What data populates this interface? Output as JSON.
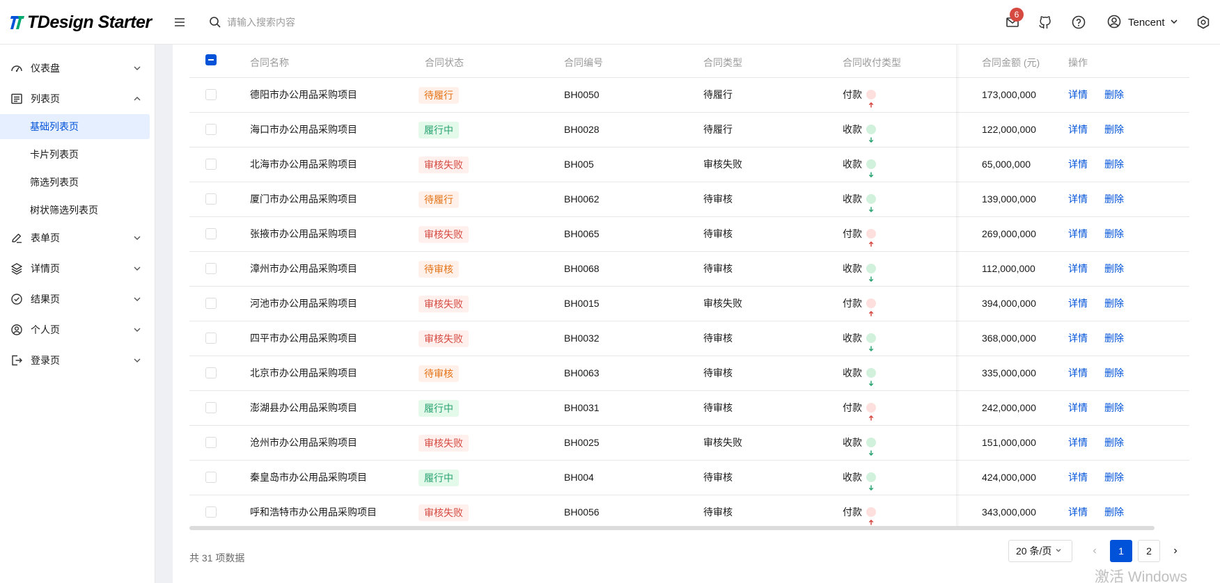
{
  "brand": {
    "name": "TDesign Starter",
    "color": "#0052d9",
    "accent": "#00a870"
  },
  "header": {
    "search_placeholder": "请输入搜索内容",
    "notification_count": "6",
    "user_name": "Tencent"
  },
  "sidebar": {
    "items": [
      {
        "label": "仪表盘",
        "icon": "dashboard-icon",
        "expanded": false
      },
      {
        "label": "列表页",
        "icon": "list-icon",
        "expanded": true,
        "children": [
          {
            "label": "基础列表页",
            "active": true
          },
          {
            "label": "卡片列表页",
            "active": false
          },
          {
            "label": "筛选列表页",
            "active": false
          },
          {
            "label": "树状筛选列表页",
            "active": false
          }
        ]
      },
      {
        "label": "表单页",
        "icon": "edit-icon",
        "expanded": false
      },
      {
        "label": "详情页",
        "icon": "layers-icon",
        "expanded": false
      },
      {
        "label": "结果页",
        "icon": "check-circle-icon",
        "expanded": false
      },
      {
        "label": "个人页",
        "icon": "user-circle-icon",
        "expanded": false
      },
      {
        "label": "登录页",
        "icon": "logout-icon",
        "expanded": false
      }
    ]
  },
  "table": {
    "columns": [
      "合同名称",
      "合同状态",
      "合同编号",
      "合同类型",
      "合同收付类型",
      "合同金额 (元)",
      "操作"
    ],
    "actions": {
      "detail": "详情",
      "delete": "删除"
    },
    "rows": [
      {
        "name": "德阳市办公用品采购项目",
        "status": "待履行",
        "status_type": "warning",
        "code": "BH0050",
        "type": "待履行",
        "pay": "付款",
        "dir": "up",
        "amount": "173,000,000"
      },
      {
        "name": "海口市办公用品采购项目",
        "status": "履行中",
        "status_type": "success",
        "code": "BH0028",
        "type": "待履行",
        "pay": "收款",
        "dir": "down",
        "amount": "122,000,000"
      },
      {
        "name": "北海市办公用品采购项目",
        "status": "审核失败",
        "status_type": "error",
        "code": "BH005",
        "type": "审核失败",
        "pay": "收款",
        "dir": "down",
        "amount": "65,000,000"
      },
      {
        "name": "厦门市办公用品采购项目",
        "status": "待履行",
        "status_type": "warning",
        "code": "BH0062",
        "type": "待审核",
        "pay": "收款",
        "dir": "down",
        "amount": "139,000,000"
      },
      {
        "name": "张掖市办公用品采购项目",
        "status": "审核失败",
        "status_type": "error",
        "code": "BH0065",
        "type": "待审核",
        "pay": "付款",
        "dir": "up",
        "amount": "269,000,000"
      },
      {
        "name": "漳州市办公用品采购项目",
        "status": "待审核",
        "status_type": "warning",
        "code": "BH0068",
        "type": "待审核",
        "pay": "收款",
        "dir": "down",
        "amount": "112,000,000"
      },
      {
        "name": "河池市办公用品采购项目",
        "status": "审核失败",
        "status_type": "error",
        "code": "BH0015",
        "type": "审核失败",
        "pay": "付款",
        "dir": "up",
        "amount": "394,000,000"
      },
      {
        "name": "四平市办公用品采购项目",
        "status": "审核失败",
        "status_type": "error",
        "code": "BH0032",
        "type": "待审核",
        "pay": "收款",
        "dir": "down",
        "amount": "368,000,000"
      },
      {
        "name": "北京市办公用品采购项目",
        "status": "待审核",
        "status_type": "warning",
        "code": "BH0063",
        "type": "待审核",
        "pay": "收款",
        "dir": "down",
        "amount": "335,000,000"
      },
      {
        "name": "澎湖县办公用品采购项目",
        "status": "履行中",
        "status_type": "success",
        "code": "BH0031",
        "type": "待审核",
        "pay": "付款",
        "dir": "up",
        "amount": "242,000,000"
      },
      {
        "name": "沧州市办公用品采购项目",
        "status": "审核失败",
        "status_type": "error",
        "code": "BH0025",
        "type": "审核失败",
        "pay": "收款",
        "dir": "down",
        "amount": "151,000,000"
      },
      {
        "name": "秦皇岛市办公用品采购项目",
        "status": "履行中",
        "status_type": "success",
        "code": "BH004",
        "type": "待审核",
        "pay": "收款",
        "dir": "down",
        "amount": "424,000,000"
      },
      {
        "name": "呼和浩特市办公用品采购项目",
        "status": "审核失败",
        "status_type": "error",
        "code": "BH0056",
        "type": "待审核",
        "pay": "付款",
        "dir": "up",
        "amount": "343,000,000"
      }
    ]
  },
  "pagination": {
    "total_text": "共 31 项数据",
    "page_size": "20 条/页",
    "pages": [
      "1",
      "2"
    ],
    "current": "1"
  },
  "watermark": "激活 Windows"
}
